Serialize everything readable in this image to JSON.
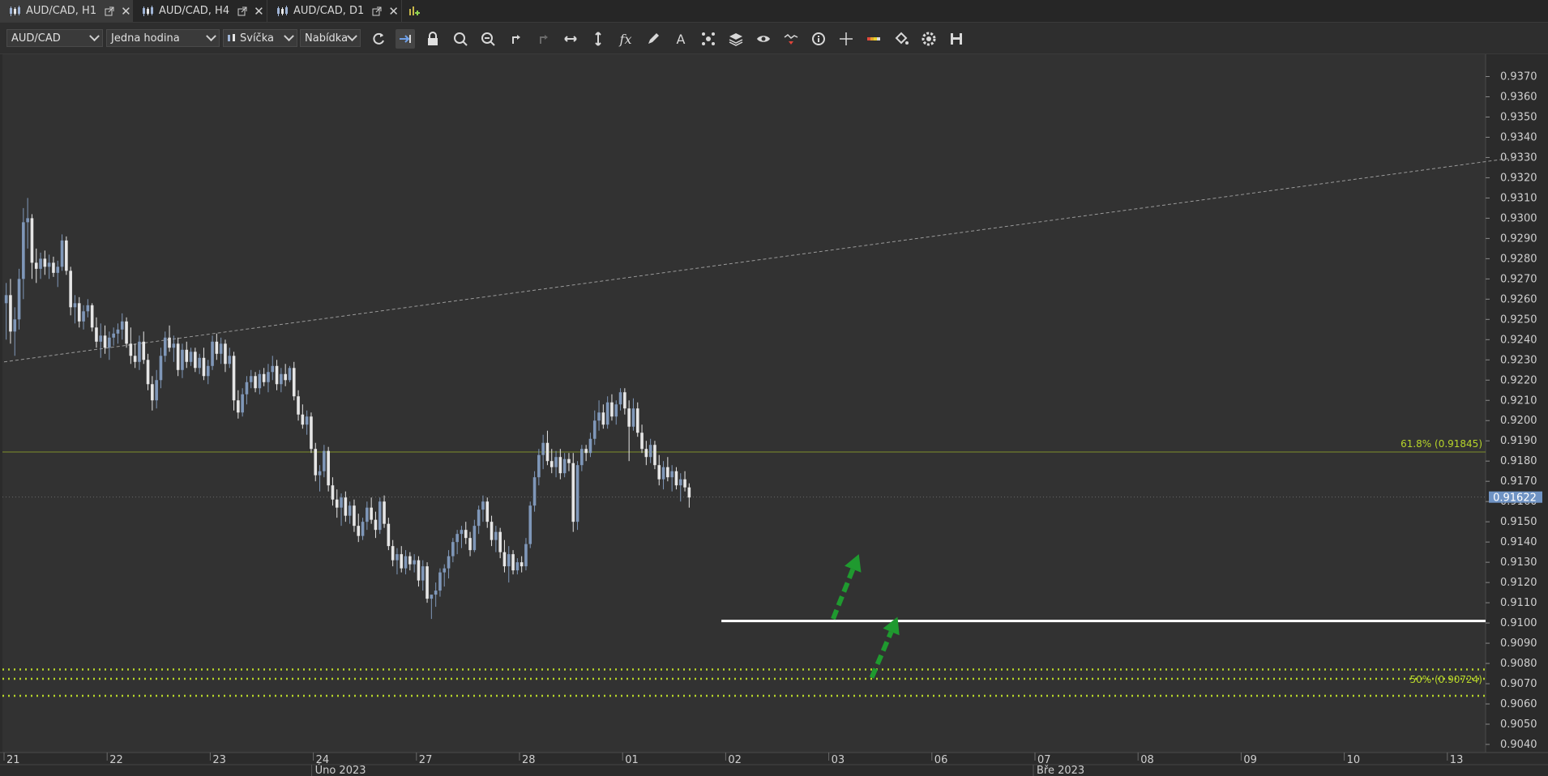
{
  "tabs": [
    {
      "label": "AUD/CAD, H1",
      "active": true
    },
    {
      "label": "AUD/CAD, H4",
      "active": false
    },
    {
      "label": "AUD/CAD, D1",
      "active": false
    }
  ],
  "toolbar": {
    "instrument": "AUD/CAD",
    "period": "Jedna hodina",
    "chart_type": "Svíčka",
    "price_side": "Nabídka",
    "icons": [
      "refresh-icon",
      "autoscroll-icon",
      "lock-icon",
      "zoom-in-icon",
      "zoom-out-icon",
      "undo-icon",
      "redo-icon",
      "horizontal-scale-icon",
      "vertical-scale-icon",
      "indicators-icon",
      "pencil-icon",
      "text-icon",
      "objects-icon",
      "layers-icon",
      "eye-icon",
      "signals-icon",
      "info-icon",
      "crosshair-icon",
      "theme-icon",
      "paint-bucket-icon",
      "settings-icon",
      "save-icon"
    ]
  },
  "colors": {
    "background": "#2b2b2b",
    "candle_up": "#7f97b9",
    "candle_down": "#e6e6e6",
    "fib_line": "#b7d52a",
    "level_line": "#ffffff",
    "arrow": "#1f9a2f",
    "current_price_bg": "#6f93c4",
    "trendline": "#9a9a9a"
  },
  "chart_data": {
    "type": "candlestick",
    "symbol": "AUD/CAD",
    "timeframe": "H1",
    "y_range": [
      0.9036,
      0.9381
    ],
    "y_ticks": [
      "0.9370",
      "0.9360",
      "0.9350",
      "0.9340",
      "0.9330",
      "0.9320",
      "0.9310",
      "0.9300",
      "0.9290",
      "0.9280",
      "0.9270",
      "0.9260",
      "0.9250",
      "0.9240",
      "0.9230",
      "0.9220",
      "0.9210",
      "0.9200",
      "0.9190",
      "0.9180",
      "0.9170",
      "0.9160",
      "0.9150",
      "0.9140",
      "0.9130",
      "0.9120",
      "0.9110",
      "0.9100",
      "0.9090",
      "0.9080",
      "0.9070",
      "0.9060",
      "0.9050",
      "0.9040"
    ],
    "x_ticks": [
      "21",
      "22",
      "23",
      "24",
      "27",
      "28",
      "01",
      "02",
      "03",
      "06",
      "07",
      "08",
      "09",
      "10",
      "13"
    ],
    "x_tick_hours": [
      0,
      24,
      48,
      72,
      96,
      120,
      144,
      168,
      192,
      216,
      240,
      264,
      288,
      312,
      336
    ],
    "month_labels": [
      {
        "label": "Úno 2023",
        "hour": 72
      },
      {
        "label": "Bře 2023",
        "hour": 240
      }
    ],
    "current_price": "0.91622",
    "current_price_value": 0.91622,
    "fib_levels": [
      {
        "label": "61.8% (0.91845)",
        "value": 0.91845,
        "style": "thin"
      },
      {
        "label": "50% (0.90724)",
        "value": 0.90724,
        "style": "dotted"
      }
    ],
    "support_dotted": [
      0.9077,
      0.9064
    ],
    "horizontal_level": {
      "value": 0.9101,
      "from_hour": 167
    },
    "trendline": {
      "start": {
        "hour": 0,
        "price": 0.9229
      },
      "end": {
        "hour": 352,
        "price": 0.933
      }
    },
    "arrows": [
      {
        "from": {
          "hour": 193,
          "price": 0.9102
        },
        "to": {
          "hour": 199,
          "price": 0.9134
        }
      },
      {
        "from": {
          "hour": 202,
          "price": 0.9073
        },
        "to": {
          "hour": 208,
          "price": 0.9103
        }
      }
    ],
    "candles": [
      [
        0.9258,
        0.9268,
        0.924,
        0.9262
      ],
      [
        0.9262,
        0.927,
        0.9238,
        0.9244
      ],
      [
        0.9244,
        0.9256,
        0.9232,
        0.925
      ],
      [
        0.925,
        0.9275,
        0.9245,
        0.927
      ],
      [
        0.927,
        0.9305,
        0.926,
        0.9298
      ],
      [
        0.9298,
        0.931,
        0.9285,
        0.93
      ],
      [
        0.93,
        0.9302,
        0.927,
        0.9278
      ],
      [
        0.9278,
        0.9285,
        0.9268,
        0.9275
      ],
      [
        0.9275,
        0.9283,
        0.927,
        0.928
      ],
      [
        0.928,
        0.9284,
        0.9272,
        0.9276
      ],
      [
        0.9276,
        0.9282,
        0.927,
        0.9278
      ],
      [
        0.9278,
        0.9281,
        0.9271,
        0.9273
      ],
      [
        0.9273,
        0.9279,
        0.9266,
        0.9276
      ],
      [
        0.9276,
        0.9292,
        0.9274,
        0.9289
      ],
      [
        0.9289,
        0.9291,
        0.9272,
        0.9274
      ],
      [
        0.9274,
        0.9276,
        0.9252,
        0.9256
      ],
      [
        0.9256,
        0.9262,
        0.9248,
        0.9258
      ],
      [
        0.9258,
        0.9261,
        0.9246,
        0.9249
      ],
      [
        0.9249,
        0.9257,
        0.9245,
        0.9254
      ],
      [
        0.9254,
        0.926,
        0.9251,
        0.9257
      ],
      [
        0.9257,
        0.9258,
        0.9244,
        0.9246
      ],
      [
        0.9246,
        0.9251,
        0.9236,
        0.9239
      ],
      [
        0.9239,
        0.9248,
        0.9231,
        0.9242
      ],
      [
        0.9242,
        0.9247,
        0.9233,
        0.9236
      ],
      [
        0.9236,
        0.9244,
        0.923,
        0.9241
      ],
      [
        0.9241,
        0.9246,
        0.9237,
        0.9243
      ],
      [
        0.9243,
        0.9248,
        0.9238,
        0.9245
      ],
      [
        0.9245,
        0.9253,
        0.924,
        0.9249
      ],
      [
        0.9249,
        0.9251,
        0.9236,
        0.9238
      ],
      [
        0.9238,
        0.9246,
        0.9228,
        0.9232
      ],
      [
        0.9232,
        0.9238,
        0.9226,
        0.9229
      ],
      [
        0.9229,
        0.9242,
        0.9225,
        0.9239
      ],
      [
        0.9239,
        0.9244,
        0.9228,
        0.923
      ],
      [
        0.923,
        0.9233,
        0.9215,
        0.9218
      ],
      [
        0.9218,
        0.9222,
        0.9205,
        0.921
      ],
      [
        0.921,
        0.9225,
        0.9206,
        0.922
      ],
      [
        0.922,
        0.9236,
        0.9216,
        0.9232
      ],
      [
        0.9232,
        0.9244,
        0.9229,
        0.9241
      ],
      [
        0.9241,
        0.9247,
        0.9234,
        0.9236
      ],
      [
        0.9236,
        0.9242,
        0.9229,
        0.9238
      ],
      [
        0.9238,
        0.9241,
        0.9222,
        0.9225
      ],
      [
        0.9225,
        0.9238,
        0.9221,
        0.9235
      ],
      [
        0.9235,
        0.9239,
        0.9226,
        0.9229
      ],
      [
        0.9229,
        0.9236,
        0.9227,
        0.9234
      ],
      [
        0.9234,
        0.9236,
        0.9224,
        0.9226
      ],
      [
        0.9226,
        0.9233,
        0.9223,
        0.9231
      ],
      [
        0.9231,
        0.9236,
        0.922,
        0.9222
      ],
      [
        0.9222,
        0.923,
        0.9218,
        0.9227
      ],
      [
        0.9227,
        0.9242,
        0.9225,
        0.9239
      ],
      [
        0.9239,
        0.9243,
        0.923,
        0.9233
      ],
      [
        0.9233,
        0.9241,
        0.9228,
        0.9238
      ],
      [
        0.9238,
        0.924,
        0.9224,
        0.9228
      ],
      [
        0.9228,
        0.9236,
        0.9226,
        0.9232
      ],
      [
        0.9232,
        0.9234,
        0.9205,
        0.921
      ],
      [
        0.921,
        0.9215,
        0.9201,
        0.9204
      ],
      [
        0.9204,
        0.9216,
        0.9202,
        0.9213
      ],
      [
        0.9213,
        0.9222,
        0.9208,
        0.9219
      ],
      [
        0.9219,
        0.9225,
        0.9216,
        0.9222
      ],
      [
        0.9222,
        0.9224,
        0.9214,
        0.9216
      ],
      [
        0.9216,
        0.9225,
        0.9213,
        0.9223
      ],
      [
        0.9223,
        0.9226,
        0.9217,
        0.9219
      ],
      [
        0.9219,
        0.9228,
        0.9214,
        0.9224
      ],
      [
        0.9224,
        0.9232,
        0.922,
        0.9227
      ],
      [
        0.9227,
        0.923,
        0.9215,
        0.9218
      ],
      [
        0.9218,
        0.9226,
        0.9214,
        0.9223
      ],
      [
        0.9223,
        0.9228,
        0.9217,
        0.922
      ],
      [
        0.922,
        0.9227,
        0.9219,
        0.9226
      ],
      [
        0.9226,
        0.9229,
        0.921,
        0.9212
      ],
      [
        0.9212,
        0.9215,
        0.92,
        0.9203
      ],
      [
        0.9203,
        0.9208,
        0.9196,
        0.9198
      ],
      [
        0.9198,
        0.9205,
        0.9193,
        0.9202
      ],
      [
        0.9202,
        0.9204,
        0.9184,
        0.9186
      ],
      [
        0.9186,
        0.9189,
        0.917,
        0.9173
      ],
      [
        0.9173,
        0.9178,
        0.9165,
        0.9175
      ],
      [
        0.9175,
        0.9188,
        0.9172,
        0.9185
      ],
      [
        0.9185,
        0.9187,
        0.9165,
        0.9168
      ],
      [
        0.9168,
        0.9172,
        0.9158,
        0.9161
      ],
      [
        0.9161,
        0.9166,
        0.9152,
        0.9157
      ],
      [
        0.9157,
        0.9164,
        0.9148,
        0.9162
      ],
      [
        0.9162,
        0.9165,
        0.915,
        0.9153
      ],
      [
        0.9153,
        0.916,
        0.9149,
        0.9158
      ],
      [
        0.9158,
        0.9161,
        0.9145,
        0.9148
      ],
      [
        0.9148,
        0.9154,
        0.914,
        0.9143
      ],
      [
        0.9143,
        0.9152,
        0.9141,
        0.915
      ],
      [
        0.915,
        0.916,
        0.9146,
        0.9157
      ],
      [
        0.9157,
        0.9162,
        0.9149,
        0.9151
      ],
      [
        0.9151,
        0.9155,
        0.9142,
        0.9146
      ],
      [
        0.9146,
        0.9162,
        0.9144,
        0.916
      ],
      [
        0.916,
        0.9163,
        0.9147,
        0.9149
      ],
      [
        0.9149,
        0.9152,
        0.9136,
        0.9138
      ],
      [
        0.9138,
        0.9141,
        0.9128,
        0.9131
      ],
      [
        0.9131,
        0.9137,
        0.9124,
        0.9134
      ],
      [
        0.9134,
        0.9138,
        0.9125,
        0.9127
      ],
      [
        0.9127,
        0.9136,
        0.9124,
        0.9133
      ],
      [
        0.9133,
        0.9135,
        0.9126,
        0.9129
      ],
      [
        0.9129,
        0.9134,
        0.9125,
        0.9131
      ],
      [
        0.9131,
        0.9133,
        0.9118,
        0.9121
      ],
      [
        0.9121,
        0.9131,
        0.9116,
        0.9128
      ],
      [
        0.9128,
        0.913,
        0.911,
        0.9112
      ],
      [
        0.9112,
        0.9114,
        0.9102,
        0.9114
      ],
      [
        0.9114,
        0.912,
        0.9108,
        0.9116
      ],
      [
        0.9116,
        0.9127,
        0.9113,
        0.9125
      ],
      [
        0.9125,
        0.9129,
        0.9118,
        0.9127
      ],
      [
        0.9127,
        0.9136,
        0.9122,
        0.9133
      ],
      [
        0.9133,
        0.9142,
        0.913,
        0.914
      ],
      [
        0.914,
        0.9146,
        0.9134,
        0.9144
      ],
      [
        0.9144,
        0.9148,
        0.9137,
        0.9146
      ],
      [
        0.9146,
        0.915,
        0.9139,
        0.9142
      ],
      [
        0.9142,
        0.9145,
        0.9133,
        0.9136
      ],
      [
        0.9136,
        0.9151,
        0.9135,
        0.9148
      ],
      [
        0.9148,
        0.9158,
        0.9144,
        0.9156
      ],
      [
        0.9156,
        0.9163,
        0.915,
        0.916
      ],
      [
        0.916,
        0.9162,
        0.9147,
        0.915
      ],
      [
        0.915,
        0.9153,
        0.9138,
        0.9141
      ],
      [
        0.9141,
        0.9148,
        0.9135,
        0.9145
      ],
      [
        0.9145,
        0.9147,
        0.9132,
        0.9135
      ],
      [
        0.9135,
        0.9141,
        0.9125,
        0.9128
      ],
      [
        0.9128,
        0.9138,
        0.912,
        0.9134
      ],
      [
        0.9134,
        0.9136,
        0.9124,
        0.9126
      ],
      [
        0.9126,
        0.9132,
        0.9124,
        0.913
      ],
      [
        0.913,
        0.9133,
        0.9125,
        0.9128
      ],
      [
        0.9128,
        0.9142,
        0.9126,
        0.9139
      ],
      [
        0.9139,
        0.916,
        0.9137,
        0.9158
      ],
      [
        0.9158,
        0.9175,
        0.9155,
        0.9172
      ],
      [
        0.9172,
        0.9186,
        0.9168,
        0.9183
      ],
      [
        0.9183,
        0.9193,
        0.9176,
        0.9189
      ],
      [
        0.9189,
        0.9195,
        0.9178,
        0.918
      ],
      [
        0.918,
        0.9186,
        0.9174,
        0.9177
      ],
      [
        0.9177,
        0.9185,
        0.9172,
        0.9182
      ],
      [
        0.9182,
        0.9186,
        0.9171,
        0.9174
      ],
      [
        0.9174,
        0.9184,
        0.9172,
        0.9181
      ],
      [
        0.9181,
        0.9184,
        0.9175,
        0.9179
      ],
      [
        0.9179,
        0.9184,
        0.9145,
        0.915
      ],
      [
        0.915,
        0.918,
        0.9146,
        0.9178
      ],
      [
        0.9178,
        0.9188,
        0.9175,
        0.9186
      ],
      [
        0.9186,
        0.9188,
        0.918,
        0.9184
      ],
      [
        0.9184,
        0.9194,
        0.9182,
        0.9191
      ],
      [
        0.9191,
        0.9205,
        0.9188,
        0.92
      ],
      [
        0.92,
        0.921,
        0.9195,
        0.9204
      ],
      [
        0.9204,
        0.9208,
        0.9196,
        0.9198
      ],
      [
        0.9198,
        0.9212,
        0.9196,
        0.9209
      ],
      [
        0.9209,
        0.9213,
        0.92,
        0.9202
      ],
      [
        0.9202,
        0.921,
        0.9198,
        0.9208
      ],
      [
        0.9208,
        0.9216,
        0.9205,
        0.9214
      ],
      [
        0.9214,
        0.9216,
        0.9203,
        0.9206
      ],
      [
        0.9206,
        0.921,
        0.918,
        0.9197
      ],
      [
        0.9197,
        0.9211,
        0.9195,
        0.9206
      ],
      [
        0.9206,
        0.9209,
        0.9192,
        0.9194
      ],
      [
        0.9194,
        0.9198,
        0.9184,
        0.9186
      ],
      [
        0.9186,
        0.919,
        0.9178,
        0.9182
      ],
      [
        0.9182,
        0.9191,
        0.9179,
        0.9188
      ],
      [
        0.9188,
        0.919,
        0.9176,
        0.9178
      ],
      [
        0.9178,
        0.9183,
        0.9168,
        0.9171
      ],
      [
        0.9171,
        0.918,
        0.9166,
        0.9177
      ],
      [
        0.9177,
        0.9182,
        0.917,
        0.9172
      ],
      [
        0.9172,
        0.9178,
        0.9165,
        0.9175
      ],
      [
        0.9175,
        0.9177,
        0.9166,
        0.9168
      ],
      [
        0.9168,
        0.9174,
        0.916,
        0.9171
      ],
      [
        0.9171,
        0.9175,
        0.9165,
        0.9167
      ],
      [
        0.9167,
        0.9169,
        0.9157,
        0.9162
      ]
    ]
  }
}
